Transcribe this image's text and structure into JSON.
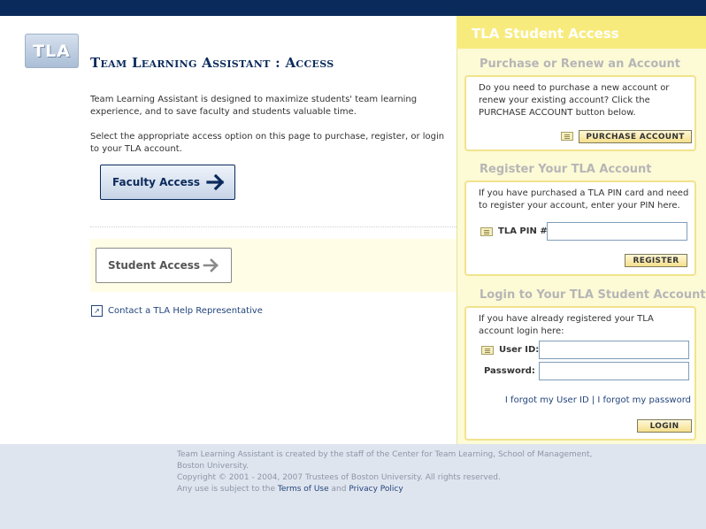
{
  "logo": {
    "text": "TLA"
  },
  "main": {
    "title": "Team Learning Assistant : Access",
    "intro": "Team Learning Assistant is designed to maximize students' team learning experience, and to save faculty and students valuable time.",
    "instruction": "Select the appropriate access option on this page to purchase, register, or login to your TLA account.",
    "faculty_button": "Faculty Access",
    "student_button": "Student Access",
    "contact_link": "Contact a TLA Help Representative"
  },
  "panel": {
    "title": "TLA Student Access",
    "purchase": {
      "heading": "Purchase or Renew an Account",
      "text": "Do you need to purchase a new account or renew your existing account? Click the PURCHASE ACCOUNT button below.",
      "button": "PURCHASE ACCOUNT"
    },
    "register": {
      "heading": "Register Your TLA Account",
      "text": "If you have purchased a TLA PIN card and need to register your account, enter your PIN here.",
      "pin_label": "TLA PIN #:",
      "pin_value": "",
      "button": "REGISTER"
    },
    "login": {
      "heading": "Login to Your TLA Student Account",
      "text": "If you have already registered your TLA account login here:",
      "user_label": "User ID:",
      "user_value": "",
      "password_label": "Password:",
      "password_value": "",
      "forgot_user": "I forgot my User ID",
      "separator": "|",
      "forgot_password": "I forgot my password",
      "button": "LOGIN"
    }
  },
  "footer": {
    "line1": "Team Learning Assistant is created by the staff of the Center for Team Learning, School of Management, Boston University.",
    "line2": "Copyright © 2001 - 2004, 2007 Trustees of Boston University. All rights reserved.",
    "line3_prefix": "Any use is subject to the",
    "terms_link": "Terms of Use",
    "and_text": "and",
    "privacy_link": "Privacy Policy"
  },
  "colors": {
    "navy": "#0b2a5c",
    "panel_yellow": "#fdfad6",
    "panel_header": "#f8eb7e",
    "link_blue": "#24457c",
    "footer_bg": "#dfe5ef"
  }
}
